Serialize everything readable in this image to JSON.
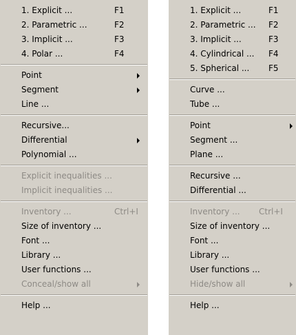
{
  "left_menu": {
    "groups": [
      [
        {
          "label": "1. Explicit ...",
          "shortcut": "F1"
        },
        {
          "label": "2. Parametric ...",
          "shortcut": "F2"
        },
        {
          "label": "3. Implicit ...",
          "shortcut": "F3"
        },
        {
          "label": "4. Polar ...",
          "shortcut": "F4"
        }
      ],
      [
        {
          "label": "Point",
          "submenu": true
        },
        {
          "label": "Segment",
          "submenu": true
        },
        {
          "label": "Line ..."
        }
      ],
      [
        {
          "label": "Recursive..."
        },
        {
          "label": "Differential",
          "submenu": true
        },
        {
          "label": "Polynomial ..."
        }
      ],
      [
        {
          "label": "Explicit inequalities ...",
          "disabled": true
        },
        {
          "label": "Implicit inequalities ...",
          "disabled": true
        }
      ],
      [
        {
          "label": "Inventory ...",
          "shortcut": "Ctrl+I",
          "disabled": true
        },
        {
          "label": "Size of inventory ..."
        },
        {
          "label": "Font ..."
        },
        {
          "label": "Library ..."
        },
        {
          "label": "User functions ..."
        },
        {
          "label": "Conceal/show all",
          "submenu": true,
          "disabled": true
        }
      ],
      [
        {
          "label": "Help ..."
        }
      ]
    ]
  },
  "right_menu": {
    "groups": [
      [
        {
          "label": "1. Explicit ...",
          "shortcut": "F1"
        },
        {
          "label": "2. Parametric ...",
          "shortcut": "F2"
        },
        {
          "label": "3. Implicit ...",
          "shortcut": "F3"
        },
        {
          "label": "4. Cylindrical ...",
          "shortcut": "F4"
        },
        {
          "label": "5. Spherical ...",
          "shortcut": "F5"
        }
      ],
      [
        {
          "label": "Curve ..."
        },
        {
          "label": "Tube ..."
        }
      ],
      [
        {
          "label": "Point",
          "submenu": true
        },
        {
          "label": "Segment ..."
        },
        {
          "label": "Plane ..."
        }
      ],
      [
        {
          "label": "Recursive ..."
        },
        {
          "label": "Differential ..."
        }
      ],
      [
        {
          "label": "Inventory ...",
          "shortcut": "Ctrl+I",
          "disabled": true
        },
        {
          "label": "Size of inventory ..."
        },
        {
          "label": "Font ..."
        },
        {
          "label": "Library ..."
        },
        {
          "label": "User functions ..."
        },
        {
          "label": "Hide/show all",
          "submenu": true,
          "disabled": true
        }
      ],
      [
        {
          "label": "Help ..."
        }
      ]
    ]
  }
}
